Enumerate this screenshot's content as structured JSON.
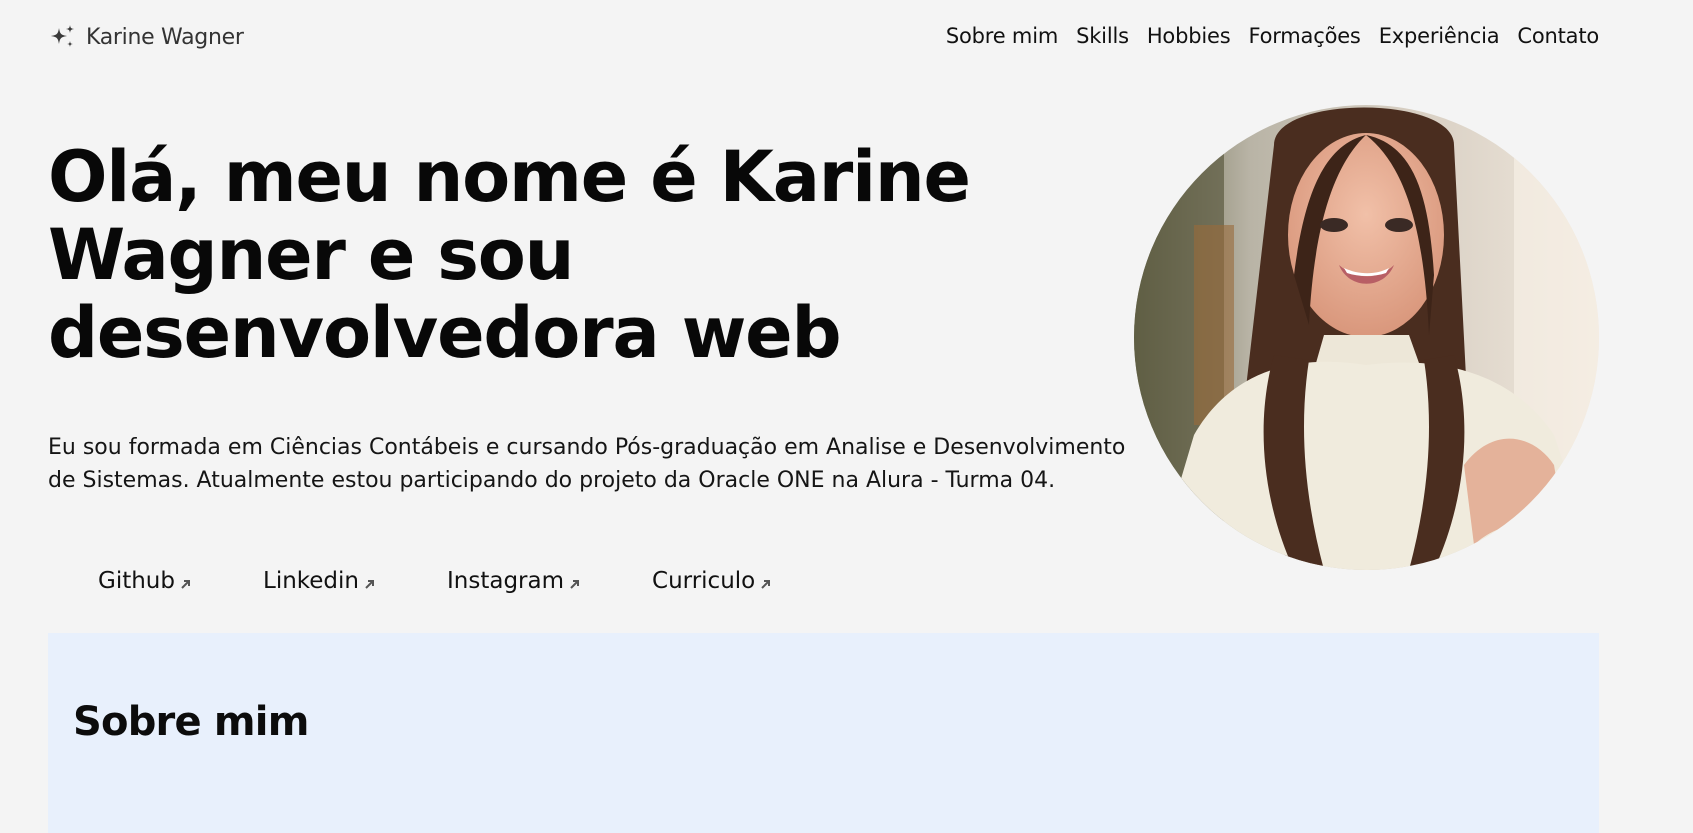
{
  "brand": {
    "name": "Karine Wagner",
    "icon": "sparkles-icon"
  },
  "nav": {
    "items": [
      {
        "label": "Sobre mim"
      },
      {
        "label": "Skills"
      },
      {
        "label": "Hobbies"
      },
      {
        "label": "Formações"
      },
      {
        "label": "Experiência"
      },
      {
        "label": "Contato"
      }
    ]
  },
  "hero": {
    "headline": "Olá, meu nome é Karine Wagner e sou desenvolvedora web",
    "intro": "Eu sou formada em Ciências Contábeis e cursando Pós-graduação em Analise e Desenvolvimento de Sistemas. Atualmente estou participando do projeto da Oracle ONE na Alura - Turma 04."
  },
  "social": {
    "links": [
      {
        "label": "Github",
        "icon": "external-link-arrow-icon"
      },
      {
        "label": "Linkedin",
        "icon": "external-link-arrow-icon"
      },
      {
        "label": "Instagram",
        "icon": "external-link-arrow-icon"
      },
      {
        "label": "Curriculo",
        "icon": "external-link-arrow-icon"
      }
    ]
  },
  "about": {
    "title": "Sobre mim"
  },
  "colors": {
    "background": "#f4f4f4",
    "about_background": "#e8f0fc",
    "text": "#111111"
  }
}
